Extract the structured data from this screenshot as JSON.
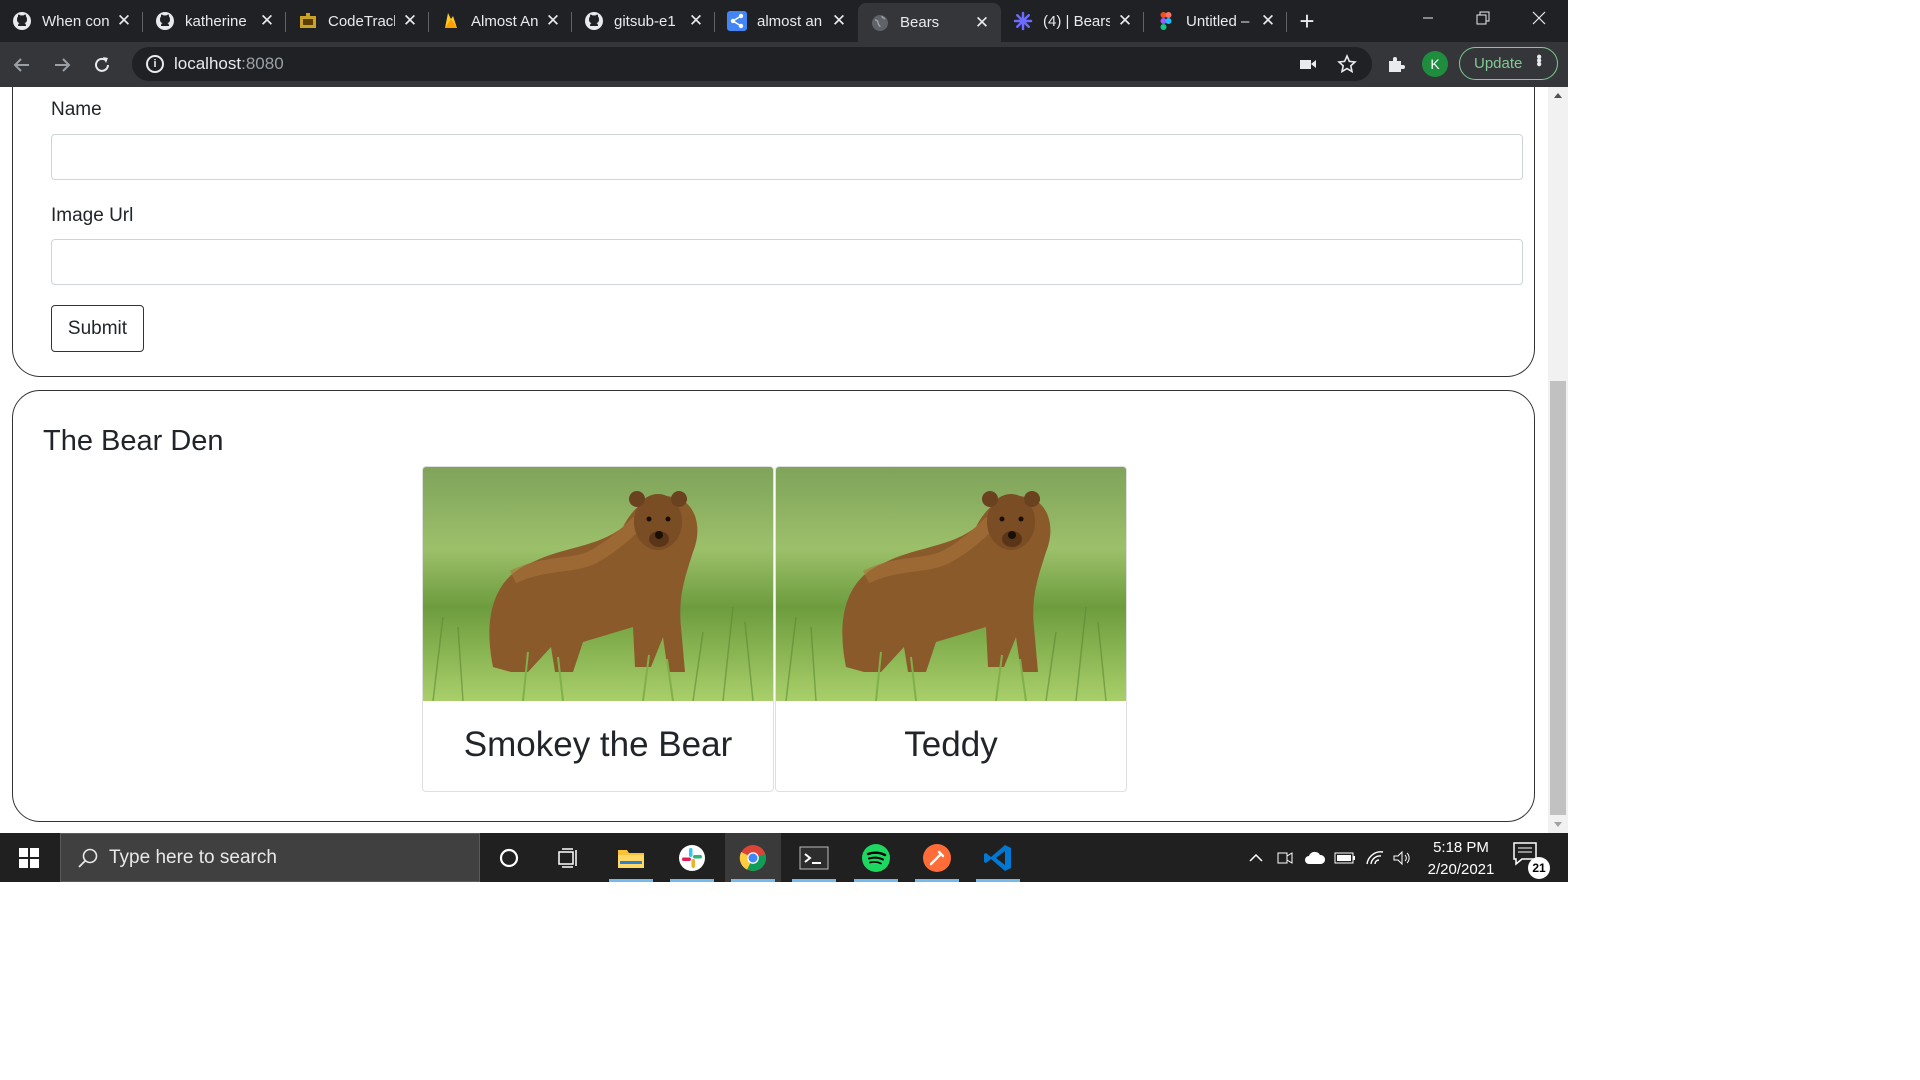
{
  "browser": {
    "tabs": [
      {
        "title": "When con",
        "icon": "github-icon"
      },
      {
        "title": "katherine",
        "icon": "github-icon"
      },
      {
        "title": "CodeTrack",
        "icon": "codetrack-icon"
      },
      {
        "title": "Almost An",
        "icon": "firebase-icon"
      },
      {
        "title": "gitsub-e1",
        "icon": "github-icon"
      },
      {
        "title": "almost an",
        "icon": "share-icon"
      },
      {
        "title": "Bears",
        "icon": "globe-icon",
        "active": true
      },
      {
        "title": "(4) | Bears",
        "icon": "atom-icon"
      },
      {
        "title": "Untitled –",
        "icon": "figma-icon"
      }
    ],
    "url_host": "localhost",
    "url_port": ":8080",
    "profile_initial": "K",
    "update_label": "Update"
  },
  "form": {
    "name_label": "Name",
    "name_value": "",
    "image_label": "Image Url",
    "image_value": "",
    "submit_label": "Submit"
  },
  "den": {
    "title": "The Bear Den",
    "bears": [
      {
        "name": "Smokey the Bear"
      },
      {
        "name": "Teddy"
      }
    ]
  },
  "taskbar": {
    "search_placeholder": "Type here to search",
    "time": "5:18 PM",
    "date": "2/20/2021",
    "notification_count": "21",
    "apps": [
      "cortana-icon",
      "task-view-icon",
      "file-explorer-icon",
      "slack-icon",
      "chrome-icon",
      "terminal-icon",
      "spotify-icon",
      "postman-icon",
      "vscode-icon"
    ]
  },
  "colors": {
    "tabstrip": "#202124",
    "toolbar": "#35363a",
    "update_green": "#81c995",
    "profile_green": "#1e8e3e",
    "taskbar": "#202020"
  }
}
